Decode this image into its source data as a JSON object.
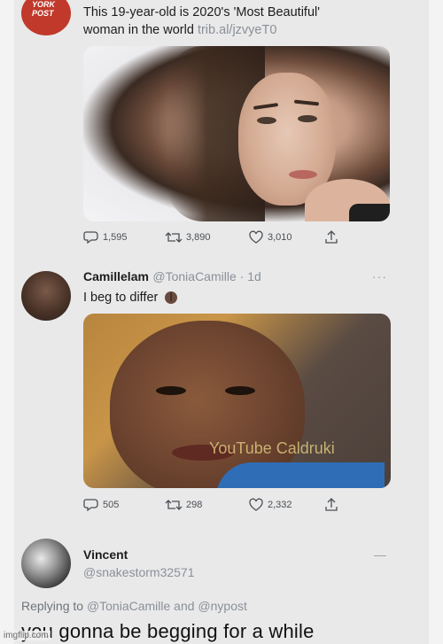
{
  "post1": {
    "avatar_text": "YORK\nPOST",
    "line1": "This 19-year-old is 2020's 'Most Beautiful'",
    "line2_text": "woman in the world ",
    "line2_link": "trib.al/jzvyeT0",
    "stats": {
      "replies": "1,595",
      "retweets": "3,890",
      "likes": "3,010"
    }
  },
  "post2": {
    "name": "Camillelam",
    "handle": "@ToniaCamille · 1d",
    "menu": "···",
    "text": "I beg to differ",
    "watermark": "YouTube Caldruki",
    "stats": {
      "replies": "505",
      "retweets": "298",
      "likes": "2,332"
    }
  },
  "post3": {
    "name": "Vincent",
    "handle": "@snakestorm32571",
    "menu": "—",
    "replying_prefix": "Replying to ",
    "replying_links": "@ToniaCamille and @nypost",
    "text": "you gonna be begging for a while"
  },
  "footer": {
    "credit": "imgflip.com"
  },
  "colors": {
    "accent_link": "#8a9099",
    "nypost_red": "#c0392b"
  }
}
